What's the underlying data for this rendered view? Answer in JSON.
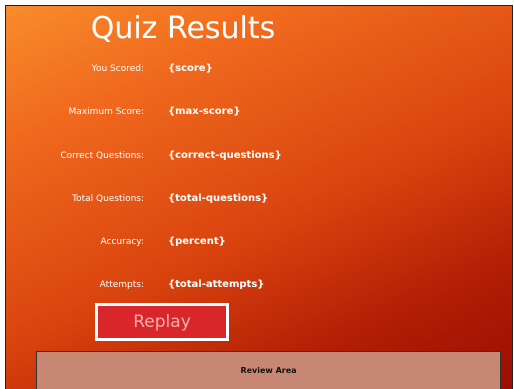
{
  "title": "Quiz Results",
  "results": [
    {
      "label": "You Scored:",
      "value": "{score}"
    },
    {
      "label": "Maximum Score:",
      "value": "{max-score}"
    },
    {
      "label": "Correct Questions:",
      "value": "{correct-questions}"
    },
    {
      "label": "Total Questions:",
      "value": "{total-questions}"
    },
    {
      "label": "Accuracy:",
      "value": "{percent}"
    },
    {
      "label": "Attempts:",
      "value": "{total-attempts}"
    }
  ],
  "replay_label": "Replay",
  "review_label": "Review Area",
  "colors": {
    "background_start": "#f88c2c",
    "background_end": "#9a0e02",
    "replay_button": "#d9262a",
    "replay_text": "#f7b0b0",
    "review_area": "#c88772"
  }
}
